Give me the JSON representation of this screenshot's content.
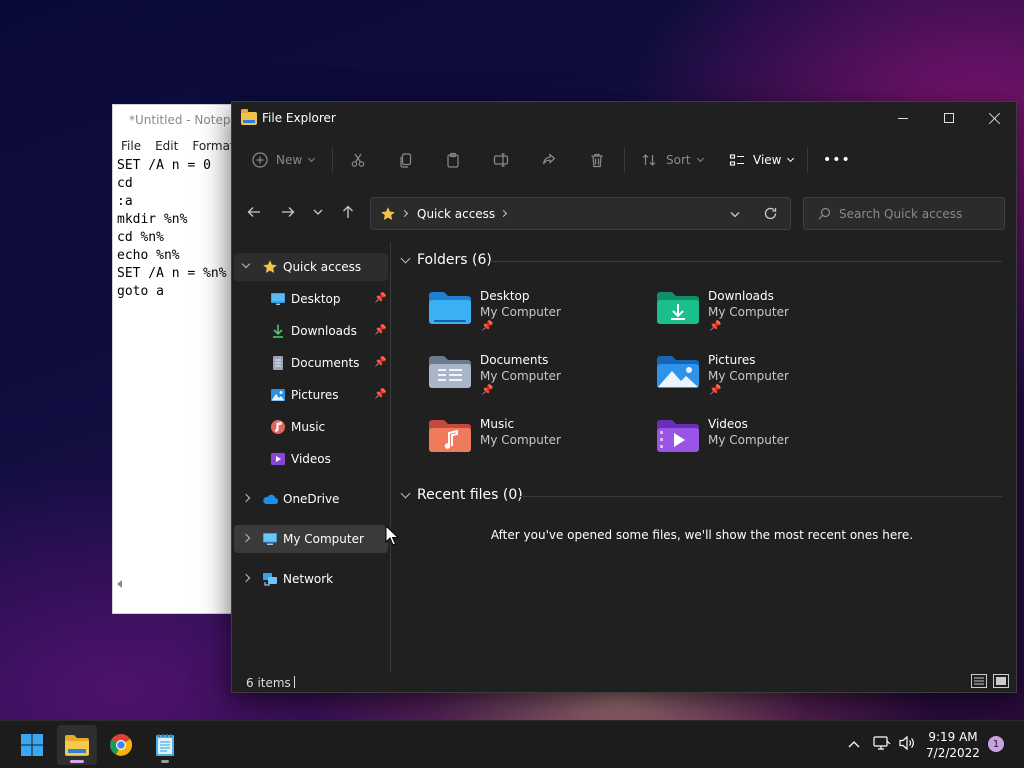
{
  "notepad": {
    "title": "*Untitled - Notepad",
    "menu": [
      "File",
      "Edit",
      "Format"
    ],
    "lines": [
      "SET /A n = 0",
      "cd",
      ":a",
      "mkdir %n%",
      "cd %n%",
      "echo %n%",
      "SET /A n = %n%",
      "goto a"
    ]
  },
  "explorer": {
    "title": "File Explorer",
    "toolbar": {
      "new_label": "New",
      "sort_label": "Sort",
      "view_label": "View",
      "more_label": "•••"
    },
    "address": {
      "crumb": "Quick access"
    },
    "search": {
      "placeholder": "Search Quick access"
    },
    "nav": {
      "quick_access": "Quick access",
      "pinned": [
        {
          "label": "Desktop",
          "pinned": true
        },
        {
          "label": "Downloads",
          "pinned": true
        },
        {
          "label": "Documents",
          "pinned": true
        },
        {
          "label": "Pictures",
          "pinned": true
        },
        {
          "label": "Music",
          "pinned": false
        },
        {
          "label": "Videos",
          "pinned": false
        }
      ],
      "onedrive": "OneDrive",
      "my_computer": "My Computer",
      "network": "Network"
    },
    "folders_header": "Folders (6)",
    "folders": [
      {
        "name": "Desktop",
        "location": "My Computer",
        "pinned": true
      },
      {
        "name": "Downloads",
        "location": "My Computer",
        "pinned": true
      },
      {
        "name": "Documents",
        "location": "My Computer",
        "pinned": true
      },
      {
        "name": "Pictures",
        "location": "My Computer",
        "pinned": true
      },
      {
        "name": "Music",
        "location": "My Computer",
        "pinned": false
      },
      {
        "name": "Videos",
        "location": "My Computer",
        "pinned": false
      }
    ],
    "recent_header": "Recent files (0)",
    "recent_empty": "After you've opened some files, we'll show the most recent ones here.",
    "status": {
      "items": "6 items"
    }
  },
  "taskbar": {
    "clock_time": "9:19 AM",
    "clock_date": "7/2/2022",
    "notification_count": "1"
  },
  "colors": {
    "accent": "#d6a6e6",
    "folder_yellow": "#f3c24b",
    "window_bg": "#202020"
  }
}
